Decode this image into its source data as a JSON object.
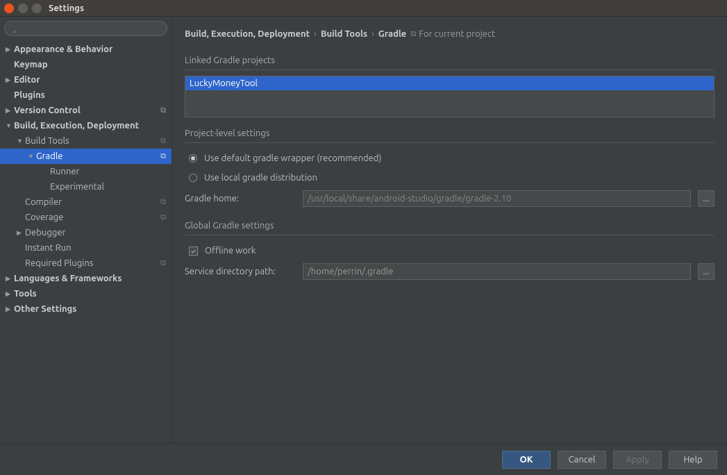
{
  "window": {
    "title": "Settings"
  },
  "search": {
    "placeholder": ""
  },
  "tree": {
    "appearance": "Appearance & Behavior",
    "keymap": "Keymap",
    "editor": "Editor",
    "plugins": "Plugins",
    "version_control": "Version Control",
    "bed": "Build, Execution, Deployment",
    "build_tools": "Build Tools",
    "gradle": "Gradle",
    "runner": "Runner",
    "experimental": "Experimental",
    "compiler": "Compiler",
    "coverage": "Coverage",
    "debugger": "Debugger",
    "instant_run": "Instant Run",
    "required_plugins": "Required Plugins",
    "languages": "Languages & Frameworks",
    "tools": "Tools",
    "other": "Other Settings"
  },
  "breadcrumb": {
    "a": "Build, Execution, Deployment",
    "b": "Build Tools",
    "c": "Gradle",
    "scope": "For current project"
  },
  "sections": {
    "linked": "Linked Gradle projects",
    "project_level": "Project-level settings",
    "global": "Global Gradle settings"
  },
  "linked_projects": [
    "LuckyMoneyTool"
  ],
  "radios": {
    "wrapper": "Use default gradle wrapper (recommended)",
    "local": "Use local gradle distribution"
  },
  "fields": {
    "gradle_home_label": "Gradle home:",
    "gradle_home_value": "/usr/local/share/android-studio/gradle/gradle-2.10",
    "service_dir_label": "Service directory path:",
    "service_dir_value": "/home/perrin/.gradle"
  },
  "checks": {
    "offline": "Offline work"
  },
  "buttons": {
    "ok": "OK",
    "cancel": "Cancel",
    "apply": "Apply",
    "help": "Help",
    "browse": "..."
  }
}
